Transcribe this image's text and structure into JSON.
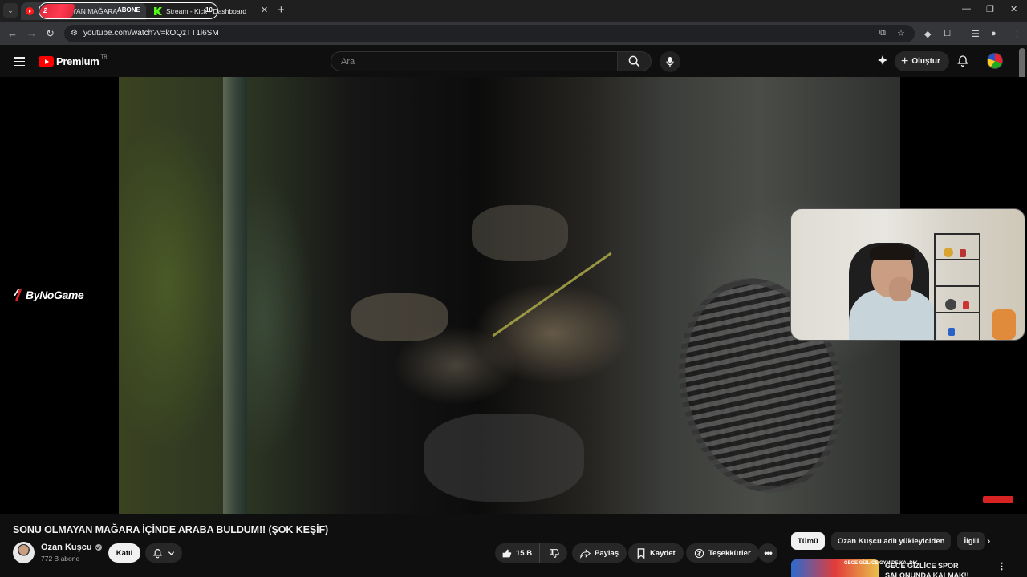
{
  "browser": {
    "tabs": [
      {
        "title": "YAN MAĞARA",
        "active": true
      },
      {
        "title": "Stream - Kick - Dashboard",
        "active": false
      }
    ],
    "overlay": {
      "badge_number": "2",
      "abone_label": "ABONE",
      "count": "10"
    },
    "url": "youtube.com/watch?v=kOQzTT1i6SM"
  },
  "youtube": {
    "logo_text": "Premium",
    "country_code": "TR",
    "search_placeholder": "Ara",
    "create_label": "Oluştur"
  },
  "watermark": {
    "brand": "ByNoGame"
  },
  "video": {
    "title": "SONU OLMAYAN MAĞARA İÇİNDE ARABA BULDUM!! (ŞOK KEŞİF)",
    "channel": "Ozan Kuşcu",
    "subscribers": "772 B abone",
    "join_label": "Katıl",
    "likes": "15 B",
    "share_label": "Paylaş",
    "save_label": "Kaydet",
    "thanks_label": "Teşekkürler"
  },
  "sidebar": {
    "chips": [
      {
        "label": "Tümü",
        "active": true
      },
      {
        "label": "Ozan Kuşcu adlı yükleyiciden",
        "active": false
      },
      {
        "label": "İlgili",
        "active": false
      }
    ],
    "recommended": [
      {
        "title": "GECE GİZLİCE SPOR SALONUNDA KALMAK!!",
        "thumb_text": "GECE GİZLİCE GYM'DE KALDIK"
      }
    ]
  },
  "colors": {
    "accent": "#ff0000",
    "background": "#0f0f0f",
    "chip_bg": "#272727"
  }
}
